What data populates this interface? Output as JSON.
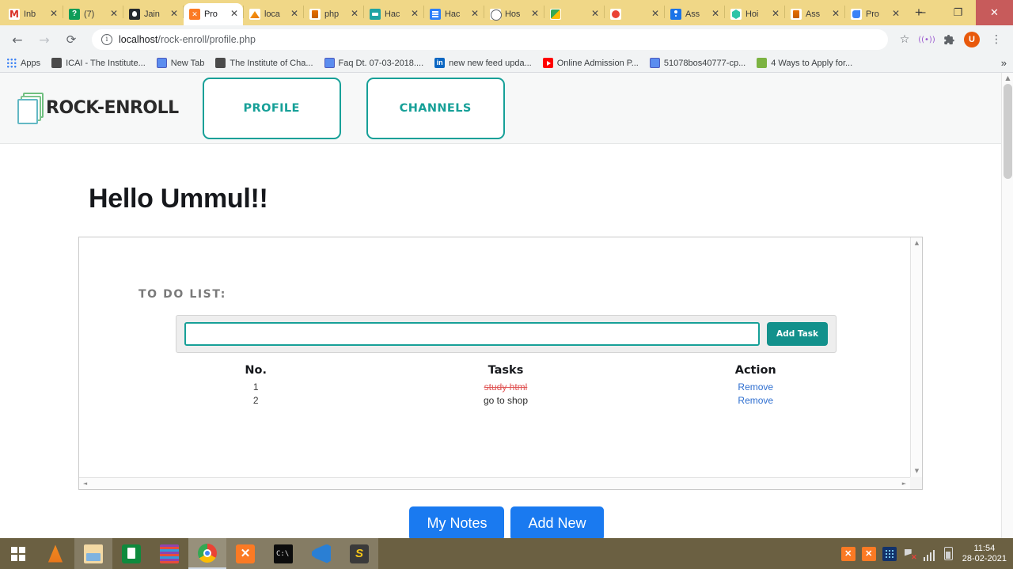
{
  "browser": {
    "tabs": [
      {
        "title": "Inb",
        "icon": "gmail-icon",
        "fv": "fv-gmail",
        "active": false
      },
      {
        "title": "(7) ",
        "icon": "whatsapp-icon",
        "fv": "fv-green",
        "active": false
      },
      {
        "title": "Jain",
        "icon": "github-icon",
        "fv": "fv-github",
        "active": false
      },
      {
        "title": "Pro",
        "icon": "xampp-icon",
        "fv": "fv-xampp",
        "active": true
      },
      {
        "title": "loca",
        "icon": "phpmyadmin-icon",
        "fv": "fv-pma",
        "active": false
      },
      {
        "title": "php",
        "icon": "php-icon",
        "fv": "fv-java",
        "active": false
      },
      {
        "title": "Hac",
        "icon": "hackerearth-icon",
        "fv": "fv-teal",
        "active": false
      },
      {
        "title": "Hac",
        "icon": "hackerrank-icon",
        "fv": "fv-blue",
        "active": false
      },
      {
        "title": "Hos",
        "icon": "globe-icon",
        "fv": "fv-globe",
        "active": false
      },
      {
        "title": "",
        "icon": "google-docs-icon",
        "fv": "fv-docs",
        "active": false
      },
      {
        "title": "",
        "icon": "record-icon",
        "fv": "fv-rec",
        "active": false
      },
      {
        "title": "Ass",
        "icon": "contacts-icon",
        "fv": "fv-contact",
        "active": false
      },
      {
        "title": "Hoi",
        "icon": "hackerearth-icon",
        "fv": "fv-hack",
        "active": false
      },
      {
        "title": "Ass",
        "icon": "java-icon",
        "fv": "fv-java",
        "active": false
      },
      {
        "title": "Pro",
        "icon": "project-icon",
        "fv": "fv-proj",
        "active": false
      }
    ],
    "new_tab_label": "+",
    "tab_close_label": "✕",
    "window_controls": {
      "minimize": "−",
      "maximize": "❐",
      "close": "✕"
    },
    "nav": {
      "back": "←",
      "forward": "→",
      "reload": "⟳"
    },
    "omnibox": {
      "info_icon": "i",
      "url_prefix": "localhost",
      "url_path": "/rock-enroll/profile.php",
      "star_icon": "☆",
      "cast_icon": "((•))",
      "extensions_icon": "🧩",
      "avatar_letter": "U",
      "menu_icon": "⋮"
    },
    "bookmarks": [
      {
        "label": "Apps",
        "icon": "apps-grid-icon",
        "cls": "bmk-apps"
      },
      {
        "label": "ICAI - The Institute...",
        "icon": "icai-icon",
        "cls": "bi-icai"
      },
      {
        "label": "New Tab",
        "icon": "globe-icon",
        "cls": "bi-globe"
      },
      {
        "label": "The Institute of Cha...",
        "icon": "icai-icon",
        "cls": "bi-icai"
      },
      {
        "label": "Faq Dt. 07-03-2018....",
        "icon": "globe-icon",
        "cls": "bi-globe"
      },
      {
        "label": "new new feed upda...",
        "icon": "linkedin-icon",
        "cls": "bi-in"
      },
      {
        "label": "Online Admission P...",
        "icon": "youtube-icon",
        "cls": "bi-yt"
      },
      {
        "label": "51078bos40777-cp...",
        "icon": "globe-icon",
        "cls": "bi-globe"
      },
      {
        "label": "4 Ways to Apply for...",
        "icon": "green-circle-icon",
        "cls": "bi-green"
      }
    ],
    "bookmarks_overflow": "»"
  },
  "site": {
    "logo_text": "ROCK-ENROLL",
    "nav": [
      {
        "label": "PROFILE"
      },
      {
        "label": "CHANNELS"
      }
    ],
    "greeting": "Hello Ummul!!",
    "todo": {
      "title": "TO DO LIST:",
      "input_value": "",
      "input_placeholder": "",
      "add_button": "Add Task",
      "columns": {
        "no": "No.",
        "task": "Tasks",
        "action": "Action"
      },
      "rows": [
        {
          "no": "1",
          "task": "study html",
          "done": true,
          "action": "Remove"
        },
        {
          "no": "2",
          "task": "go to shop",
          "done": false,
          "action": "Remove"
        }
      ]
    },
    "footer_buttons": [
      {
        "label": "My Notes"
      },
      {
        "label": "Add New"
      }
    ],
    "scroll": {
      "up": "▲",
      "down": "▼",
      "left": "◄",
      "right": "►"
    }
  },
  "colors": {
    "brand_teal": "#17a098",
    "add_task_teal": "#13918c",
    "button_blue": "#1a7af0",
    "task_done_red": "#e05555",
    "remove_link_blue": "#2f6fd0",
    "tab_strip": "#f0d787",
    "taskbar": "#6b6042"
  },
  "taskbar": {
    "start_label": "start-button",
    "items": [
      {
        "name": "vlc-icon",
        "cls": "ico-vlc",
        "state": ""
      },
      {
        "name": "file-explorer-icon",
        "cls": "ico-folder",
        "state": "open"
      },
      {
        "name": "microsoft-store-icon",
        "cls": "ico-store",
        "state": ""
      },
      {
        "name": "winrar-icon",
        "cls": "ico-rar",
        "state": ""
      },
      {
        "name": "chrome-icon",
        "cls": "ico-chrome",
        "state": "active"
      },
      {
        "name": "xampp-icon",
        "cls": "ico-xampp",
        "state": "open",
        "glyph": "✕"
      },
      {
        "name": "command-prompt-icon",
        "cls": "ico-cmd",
        "state": "open",
        "glyph": "C:\\"
      },
      {
        "name": "vscode-icon",
        "cls": "ico-vscode",
        "state": "open"
      },
      {
        "name": "sublime-text-icon",
        "cls": "ico-sublime",
        "state": "open",
        "glyph": "S"
      }
    ],
    "tray": {
      "xampp1": "✕",
      "xampp2": "✕",
      "time": "11:54",
      "date": "28-02-2021"
    }
  }
}
